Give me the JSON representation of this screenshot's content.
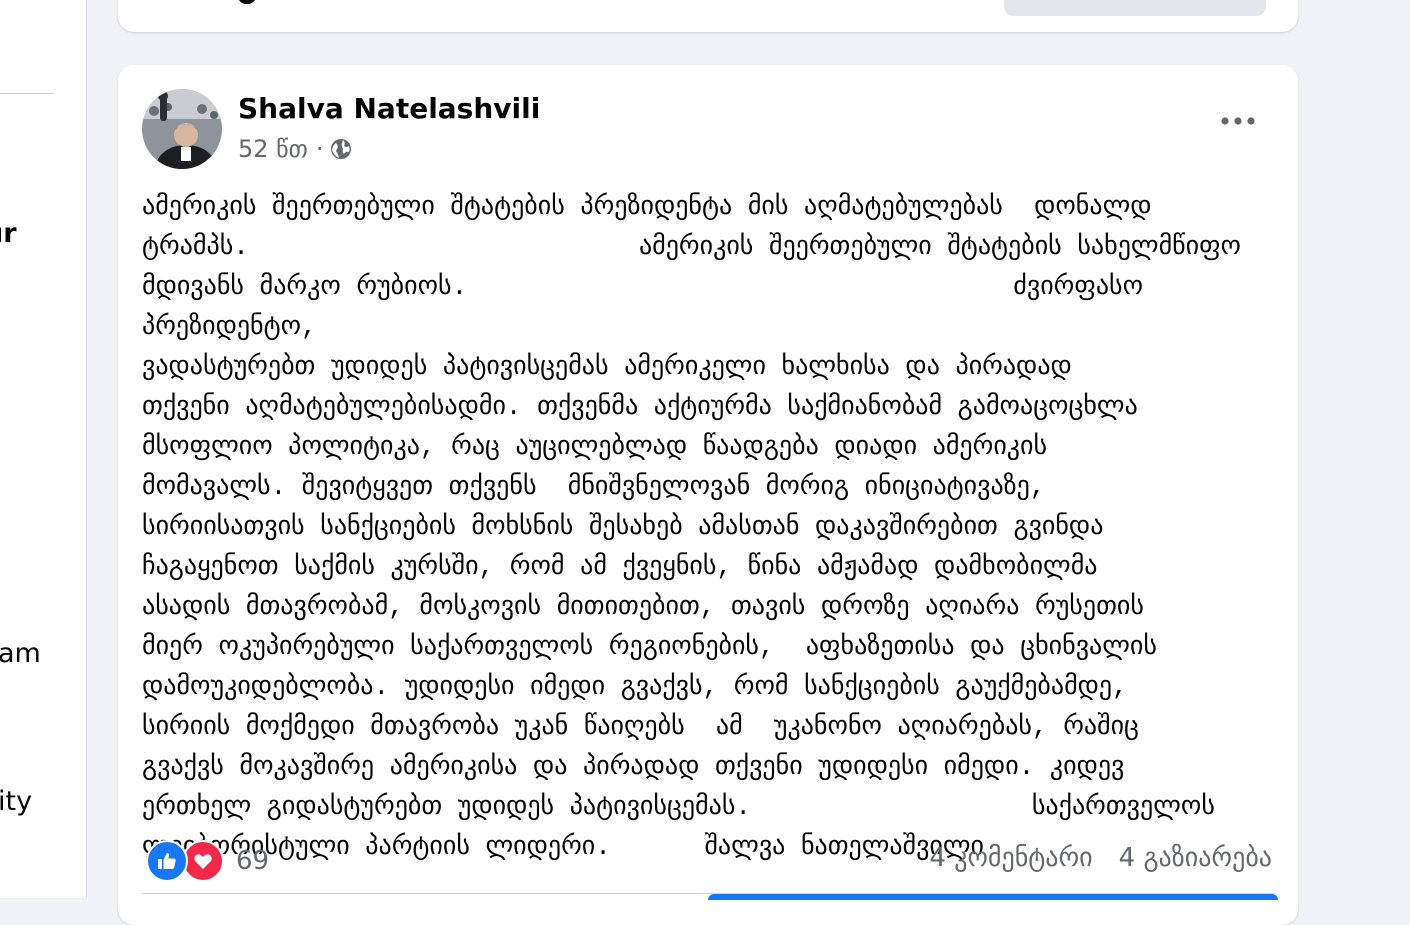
{
  "sidebar": {
    "fragments": [
      "ır",
      "am",
      "ity"
    ]
  },
  "post": {
    "author": "Shalva Natelashvili",
    "time": "52 წთ",
    "separator": "·",
    "audience_icon": "globe-icon",
    "menu_icon": "more-options-icon",
    "text": "ამერიკის შეერთებული შტატების პრეზიდენტა მის აღმატებულებას  დონალდ\nტრამპს.                         ამერიკის შეერთებული შტატების სახელმწიფო\nმდივანს მარკო რუბიოს.                                   ძვირფასო პრეზიდენტო,\nვადასტურებთ უდიდეს პატივისცემას ამერიკელი ხალხისა და პირადად\nთქვენი აღმატებულებისადმი. თქვენმა აქტიურმა საქმიანობამ გამოაცოცხლა\nმსოფლიო პოლიტიკა, რაც აუცილებლად წაადგება დიადი ამერიკის\nმომავალს. შევიტყვეთ თქვენს  მნიშვნელოვან მორიგ ინიციატივაზე,\nსირიისათვის სანქციების მოხსნის შესახებ ამასთან დაკავშირებით გვინდა\nჩაგაყენოთ საქმის კურსში, რომ ამ ქვეყნის, წინა ამჟამად დამხობილმა\nასადის მთავრობამ, მოსკოვის მითითებით, თავის დროზე აღიარა რუსეთის\nმიერ ოკუპირებული საქართველოს რეგიონების,  აფხაზეთისა და ცხინვალის\nდამოუკიდებლობა. უდიდესი იმედი გვაქვს, რომ სანქციების გაუქმებამდე,\nსირიის მოქმედი მთავრობა უკან წაიღებს  ამ  უკანონო აღიარებას, რაშიც\nგვაქვს მოკავშირე ამერიკისა და პირადად თქვენი უდიდესი იმედი. კიდევ\nერთხელ გიდასტურებთ უდიდეს პატივისცემას.                  საქართველოს\nლეიბორისტული პარტიის ლიდერი.      შალვა ნათელაშვილი",
    "reaction_count": "69",
    "comments": "4 კომენტარი",
    "shares": "4 გაზიარება",
    "colors": {
      "like": "#1877f2",
      "love": "#f02849",
      "secondary_text": "#65676b"
    }
  }
}
